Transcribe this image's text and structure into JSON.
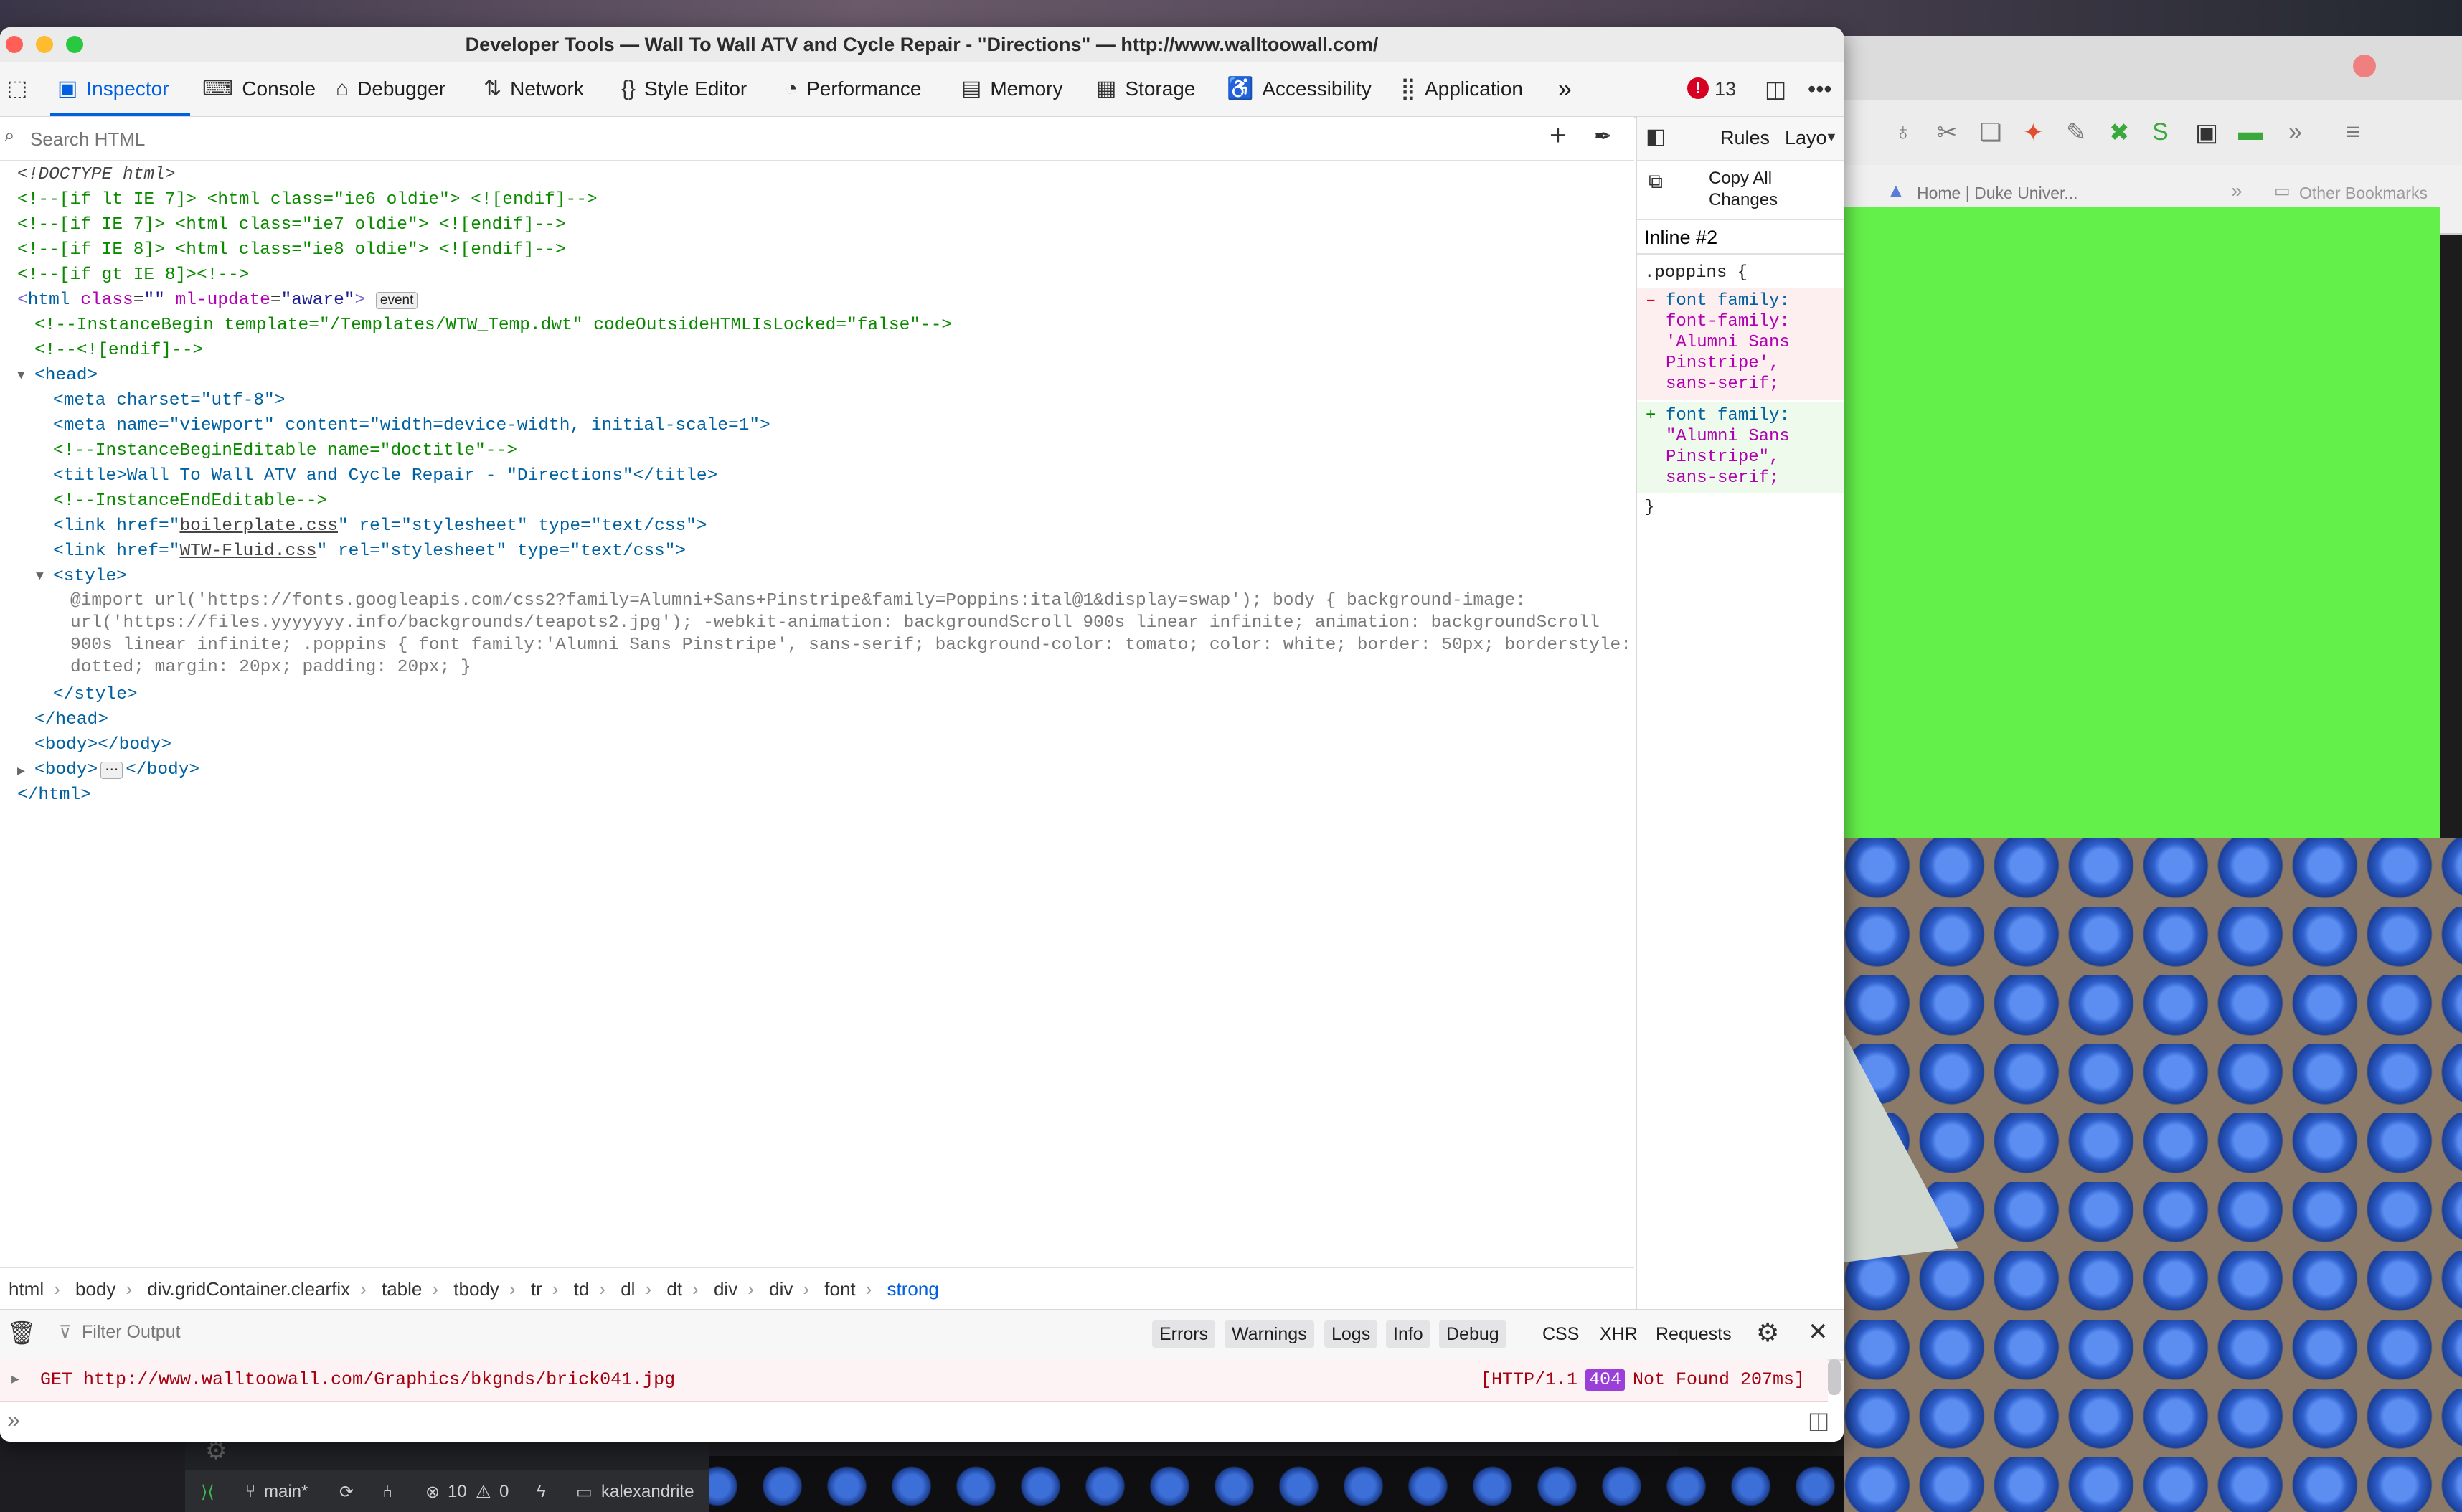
{
  "window": {
    "title": "Developer Tools — Wall To Wall ATV and Cycle Repair - \"Directions\" — http://www.walltoowall.com/"
  },
  "tabs": [
    {
      "label": "Inspector",
      "icon": "inspector-icon",
      "active": true
    },
    {
      "label": "Console",
      "icon": "console-icon"
    },
    {
      "label": "Debugger",
      "icon": "debugger-icon"
    },
    {
      "label": "Network",
      "icon": "network-icon"
    },
    {
      "label": "Style Editor",
      "icon": "style-editor-icon"
    },
    {
      "label": "Performance",
      "icon": "performance-icon"
    },
    {
      "label": "Memory",
      "icon": "memory-icon"
    },
    {
      "label": "Storage",
      "icon": "storage-icon"
    },
    {
      "label": "Accessibility",
      "icon": "accessibility-icon"
    },
    {
      "label": "Application",
      "icon": "application-icon"
    }
  ],
  "toolbar": {
    "error_count": "13"
  },
  "search": {
    "placeholder": "Search HTML"
  },
  "markup": {
    "doctype": "<!DOCTYPE html>",
    "cond1": "<!--[if lt IE 7]> <html class=\"ie6 oldie\"> <![endif]-->",
    "cond2": "<!--[if IE 7]> <html class=\"ie7 oldie\"> <![endif]-->",
    "cond3": "<!--[if IE 8]> <html class=\"ie8 oldie\"> <![endif]-->",
    "cond4": "<!--[if gt IE 8]><!-->",
    "html_open_tag": "html",
    "html_attr_class": "class",
    "html_val_class": "\"\"",
    "html_attr_ml": "ml-update",
    "html_val_ml": "\"aware\"",
    "event_badge": "event",
    "instance_begin": "<!--InstanceBegin template=\"/Templates/WTW_Temp.dwt\" codeOutsideHTMLIsLocked=\"false\"-->",
    "endif_comment": "<!--<![endif]-->",
    "head_open": "<head>",
    "meta_charset": "<meta charset=\"utf-8\">",
    "meta_viewport": "<meta name=\"viewport\" content=\"width=device-width, initial-scale=1\">",
    "begin_editable": "<!--InstanceBeginEditable name=\"doctitle\"-->",
    "title_line": "<title>Wall To Wall ATV and Cycle Repair - \"Directions\"</title>",
    "end_editable": "<!--InstanceEndEditable-->",
    "link1_pre": "<link href=\"",
    "link1_href": "boilerplate.css",
    "link1_post": "\" rel=\"stylesheet\" type=\"text/css\">",
    "link2_pre": "<link href=\"",
    "link2_href": "WTW-Fluid.css",
    "link2_post": "\" rel=\"stylesheet\" type=\"text/css\">",
    "style_open": "<style>",
    "css_line1": "@import url('https://fonts.googleapis.com/css2?family=Alumni+Sans+Pinstripe&family=Poppins:ital@1&display=swap'); body { background-image:",
    "css_line2": "url('https://files.yyyyyyy.info/backgrounds/teapots2.jpg'); -webkit-animation: backgroundScroll 900s linear infinite; animation: backgroundScroll",
    "css_line3": "900s linear infinite; .poppins { font family:'Alumni Sans Pinstripe', sans-serif; background-color: tomato; color: white; border: 50px; borderstyle:",
    "css_line4": "dotted; margin: 20px; padding: 20px; }",
    "style_close": "</style>",
    "head_close": "</head>",
    "body_empty": "<body></body>",
    "body_collapsed_open": "<body>",
    "body_collapsed_ellipsis": "⋯",
    "body_collapsed_close": "</body>",
    "html_close": "</html>"
  },
  "breadcrumbs": [
    "html",
    "body",
    "div.gridContainer.clearfix",
    "table",
    "tbody",
    "tr",
    "td",
    "dl",
    "dt",
    "div",
    "div",
    "font",
    "strong"
  ],
  "rules_panel": {
    "rules_tab": "Rules",
    "layout_tab": "Layo",
    "copy_all_line1": "Copy All",
    "copy_all_line2": "Changes",
    "inline_label": "Inline #2",
    "selector": ".poppins {",
    "removed_marker": "–",
    "removed_prop": "font family:",
    "removed_lines": [
      "font-family:",
      "'Alumni Sans",
      "Pinstripe',",
      "sans-serif;"
    ],
    "added_marker": "+",
    "added_prop": "font family:",
    "added_lines": [
      "\"Alumni Sans",
      "Pinstripe\",",
      "sans-serif;"
    ],
    "close_brace": "}"
  },
  "console": {
    "filter_placeholder": "Filter Output",
    "filters": [
      "Errors",
      "Warnings",
      "Logs",
      "Info",
      "Debug"
    ],
    "types": [
      "CSS",
      "XHR",
      "Requests"
    ],
    "message": {
      "method": "GET",
      "url": "http://www.walltoowall.com/Graphics/bkgnds/brick041.jpg",
      "protocol": "[HTTP/1.1",
      "status_code": "404",
      "status_text": "Not Found 207ms]"
    }
  },
  "background_browser": {
    "bookmark1": "Home | Duke Univer...",
    "bookmark2": "Other Bookmarks"
  },
  "vscode_status": {
    "branch": "main*",
    "errors": "10",
    "warnings": "0",
    "folder": "kalexandrite"
  },
  "colors": {
    "accent": "#0060df",
    "error": "#a4000f",
    "status_badge": "#9a40d8",
    "green_page": "#64f04a"
  }
}
